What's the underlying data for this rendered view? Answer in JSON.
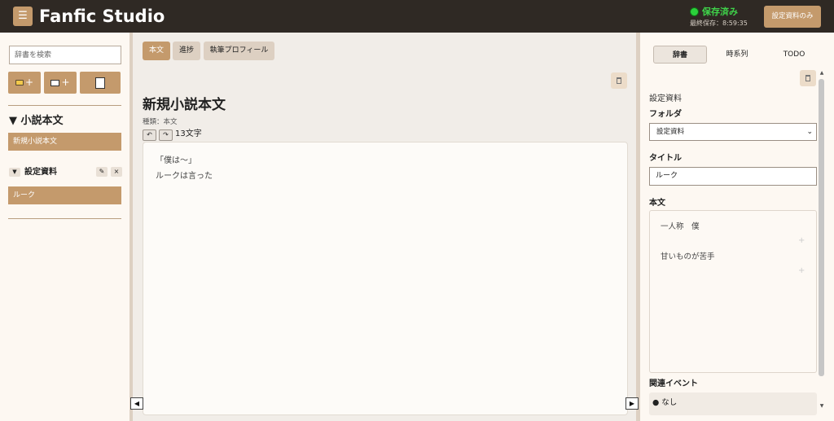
{
  "header": {
    "menu_icon": "☰",
    "app_title": "Fanfic Studio",
    "save_status": "保存済み",
    "last_saved": "最終保存：8:59:35",
    "material_button": "設定資料のみ"
  },
  "sidebar": {
    "search_placeholder": "辞書を検索",
    "buttons": [
      {
        "icon": "new-folder-icon",
        "label": "+"
      },
      {
        "icon": "new-file-icon",
        "label": "+"
      },
      {
        "icon": "edit-note-icon",
        "label": ""
      }
    ],
    "section_title": "▼ 小説本文",
    "novel_items": [
      "新規小説本文"
    ],
    "folder": {
      "toggle": "▼",
      "name": "設定資料",
      "edit_icon": "✎",
      "close_icon": "×",
      "items": [
        "ルーク"
      ]
    }
  },
  "main": {
    "tabs": [
      {
        "label": "本文",
        "active": true
      },
      {
        "label": "進捗",
        "active": false
      },
      {
        "label": "執筆プロフィール",
        "active": false
      }
    ],
    "doc_title": "新規小説本文",
    "doc_kind": "種類：本文",
    "undo": "↶",
    "redo": "↷",
    "char_count": "13文字",
    "editor_lines": [
      "「僕は〜」",
      "ルークは言った"
    ],
    "nav_left": "◀",
    "nav_right": "▶"
  },
  "right_panel": {
    "tabs": [
      {
        "label": "辞書",
        "active": true
      },
      {
        "label": "時系列",
        "active": false
      },
      {
        "label": "TODO",
        "active": false
      }
    ],
    "category": "設定資料",
    "folder_label": "フォルダ",
    "folder_value": "設定資料",
    "title_label": "タイトル",
    "title_value": "ルーク",
    "body_label": "本文",
    "body_lines": [
      "一人称　僕",
      "甘いものが苦手"
    ],
    "body_plus": "+",
    "events_label": "関連イベント",
    "events_value": "●  なし"
  },
  "colors": {
    "header_bg": "#2f2924",
    "accent": "#c49a6c",
    "saved_green": "#3fd34a",
    "panel_bg": "#fdf8f2"
  }
}
